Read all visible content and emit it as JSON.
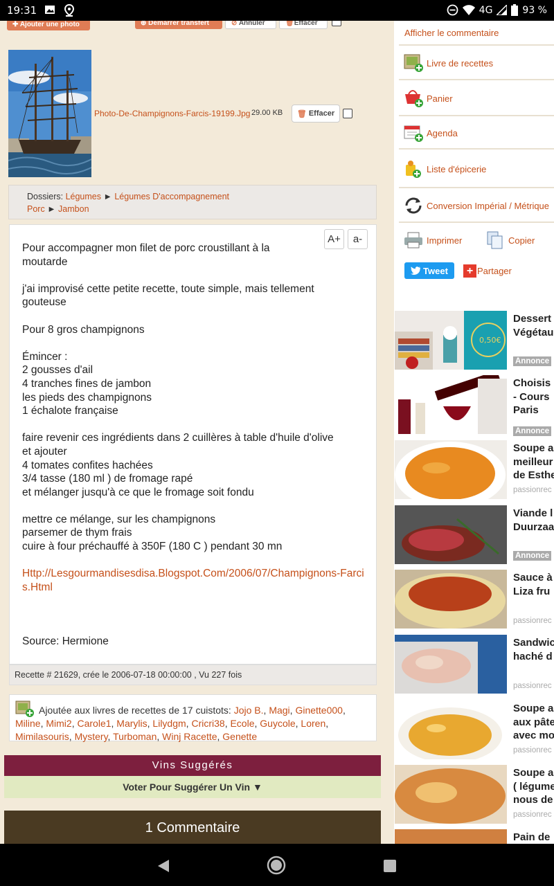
{
  "status_bar": {
    "time": "19:31",
    "network": "4G",
    "battery": "93 %"
  },
  "photo_upload": {
    "add_photo": "Ajouter une photo",
    "start_transfer": "Démarrer transfert",
    "cancel": "Annuler",
    "delete_all": "Effacer",
    "photo_filename": "Photo-De-Champignons-Farcis-19199.Jpg",
    "photo_size": "29.00 KB",
    "delete_photo": "Effacer"
  },
  "folders": {
    "label": "Dossiers:",
    "path1": [
      "Légumes",
      "Légumes D'accompagnement"
    ],
    "path2": [
      "Porc",
      "Jambon"
    ],
    "separator": "►"
  },
  "font_controls": {
    "increase": "A+",
    "decrease": "a-"
  },
  "recipe": {
    "lines": [
      "Pour accompagner mon filet de porc croustillant à la",
      "moutarde",
      "",
      "j'ai improvisé cette petite recette, toute simple, mais tellement",
      "gouteuse",
      "",
      "Pour 8 gros champignons",
      "",
      "Émincer :",
      "2 gousses d'ail",
      "4 tranches fines de jambon",
      "les pieds des champignons",
      "1 échalote française",
      "",
      "faire revenir ces ingrédients dans 2 cuillères à table d'huile d'olive",
      "et ajouter",
      "4 tomates confites hachées",
      "3/4 tasse (180 ml ) de fromage rapé",
      "et mélanger jusqu'à ce que le fromage soit fondu",
      "",
      "mettre ce mélange, sur les champignons",
      "parsemer de thym frais",
      "cuire à four préchauffé à 350F (180 C ) pendant 30 mn",
      ""
    ],
    "url": "Http://Lesgourmandisesdisa.Blogspot.Com/2006/07/Champignons-Farcis.Html",
    "source": "Source: Hermione"
  },
  "meta": "Recette # 21629, crée le 2006-07-18 00:00:00 , Vu 227 fois",
  "cooks": {
    "intro": "Ajoutée aux livres de recettes de 17 cuistots:",
    "names": [
      "Jojo B.",
      "Magi",
      "Ginette000",
      "Miline",
      "Mimi2",
      "Carole1",
      "Marylis",
      "Lilydgm",
      "Cricri38",
      "Ecole",
      "Guycole",
      "Loren",
      "Mimilasouris",
      "Mystery",
      "Turboman",
      "Winj Racette",
      "Genette"
    ]
  },
  "wines": {
    "title": "Vins Suggérés",
    "vote": "Voter Pour Suggérer Un Vin ▼"
  },
  "comments": {
    "title": "1 Commentaire"
  },
  "actions": {
    "show_comment": "Afficher le commentaire",
    "recipe_book": "Livre de recettes",
    "cart": "Panier",
    "agenda": "Agenda",
    "grocery": "Liste d'épicerie",
    "conversion": "Conversion Impérial / Métrique",
    "print": "Imprimer",
    "copy": "Copier",
    "tweet": "Tweet",
    "share": "Partager"
  },
  "ads": [
    {
      "title": "Dessert\nVégétau",
      "tag": "Annonce",
      "src": ""
    },
    {
      "title": "Choisis\n- Cours\nParis",
      "tag": "Annonce",
      "src": ""
    },
    {
      "title": "Soupe a\nmeilleur\nde Esthe",
      "tag": "",
      "src": "passionrec"
    },
    {
      "title": "Viande l\nDuurzaa",
      "tag": "Annonce",
      "src": ""
    },
    {
      "title": "Sauce à\nLiza fru",
      "tag": "",
      "src": "passionrec"
    },
    {
      "title": "Sandwic\nhaché d",
      "tag": "",
      "src": "passionrec"
    },
    {
      "title": "Soupe a\naux pâte\navec mo",
      "tag": "",
      "src": "passionrec"
    },
    {
      "title": "Soupe a\n( légume\nnous de",
      "tag": "",
      "src": "passionrec"
    },
    {
      "title": "Pain de",
      "tag": "",
      "src": ""
    }
  ],
  "promo_badge": "0,50€",
  "colors": {
    "accent": "#c5501a",
    "wine_bar": "#7d1f3e",
    "vote_bar": "#e1eac1",
    "comments_bar": "#4a3a22",
    "tweet": "#1d9bf0"
  }
}
